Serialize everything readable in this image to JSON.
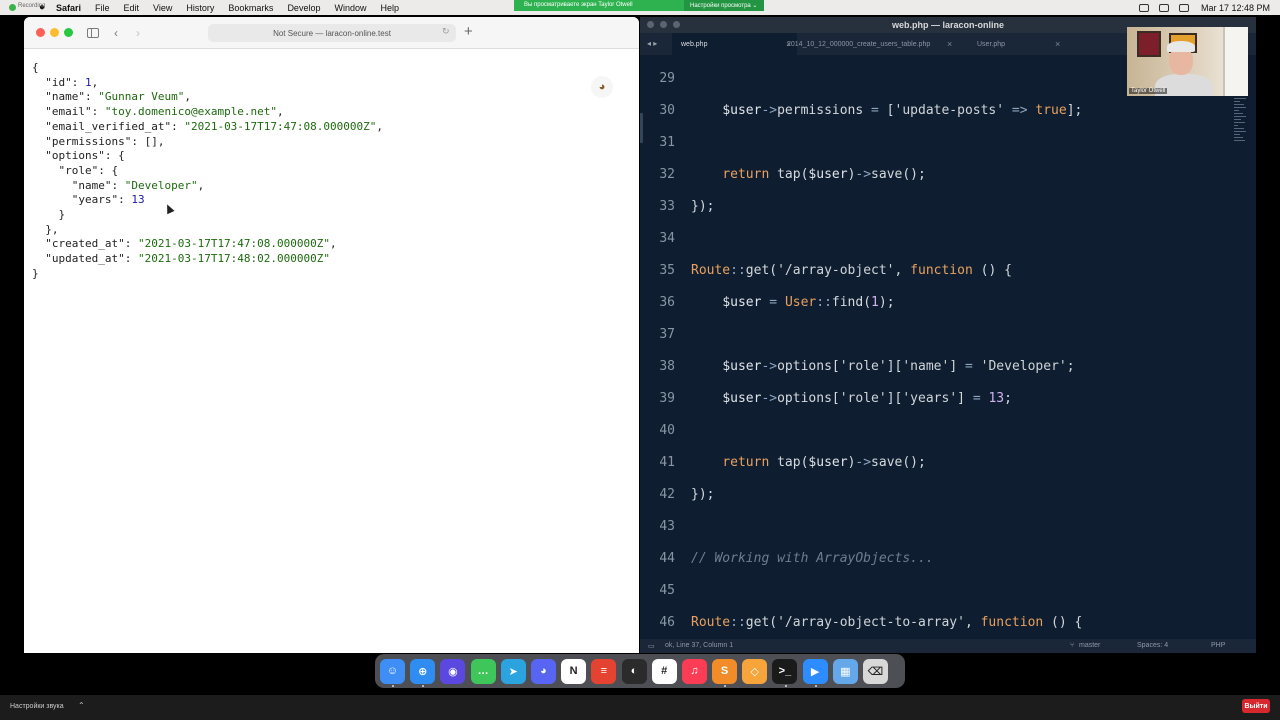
{
  "menubar": {
    "recording_label": "Recording",
    "app": "Safari",
    "items": [
      "File",
      "Edit",
      "View",
      "History",
      "Bookmarks",
      "Develop",
      "Window",
      "Help"
    ],
    "share_banner": "Вы просматриваете экран Taylor Otwell",
    "share_options": "Настройки просмотра ⌄",
    "clock": "Mar 17  12:48 PM"
  },
  "safari": {
    "address": "Not Secure — laracon-online.test",
    "json": {
      "id": "1",
      "name": "\"Gunnar Veum\"",
      "email": "\"toy.domenico@example.net\"",
      "email_verified_at": "\"2021-03-17T17:47:08.000000Z\"",
      "permissions": "[]",
      "role_name": "\"Developer\"",
      "role_years": "13",
      "created_at": "\"2021-03-17T17:47:08.000000Z\"",
      "updated_at": "\"2021-03-17T17:48:02.000000Z\""
    }
  },
  "editor": {
    "title": "web.php — laracon-online",
    "tabs": [
      "web.php",
      "2014_10_12_000000_create_users_table.php",
      "User.php"
    ],
    "status": {
      "position": "ok, Line 37, Column 1",
      "branch": "master",
      "spaces": "Spaces: 4",
      "syntax": "PHP"
    },
    "line_numbers": [
      "29",
      "30",
      "31",
      "32",
      "33",
      "34",
      "35",
      "36",
      "37",
      "38",
      "39",
      "40",
      "41",
      "42",
      "43",
      "44",
      "45",
      "46"
    ]
  },
  "webcam": {
    "name": "Taylor Otwell"
  },
  "dock": {
    "apps": [
      "finder-icon",
      "safari-icon",
      "siri-icon",
      "messages-icon",
      "telegram-icon",
      "discord-icon",
      "notion-icon",
      "todoist-icon",
      "nova-icon",
      "slack-icon",
      "music-icon",
      "sublime-icon",
      "tableplus-icon",
      "terminal-icon",
      "zoom-icon",
      "finder-stack-icon",
      "trash-icon"
    ],
    "colors": [
      "#3f8ef5",
      "#2f8cf0",
      "#5a48e0",
      "#3fc65a",
      "#2aa3df",
      "#5865f2",
      "#ffffff",
      "#e44332",
      "#2b2b2b",
      "#ffffff",
      "#fa3d55",
      "#f28c28",
      "#f7a53a",
      "#1a1a1a",
      "#2d8cff",
      "#64a8ea",
      "#d8d8d8"
    ],
    "glyphs": [
      "☺",
      "⊕",
      "◉",
      "…",
      "➤",
      "◕",
      "N",
      "≡",
      "◐",
      "#",
      "♫",
      "S",
      "◇",
      ">_",
      "▶",
      "▦",
      "⌫"
    ]
  },
  "zoom_bar": {
    "audio_settings": "Настройки звука",
    "exit": "Выйти"
  }
}
